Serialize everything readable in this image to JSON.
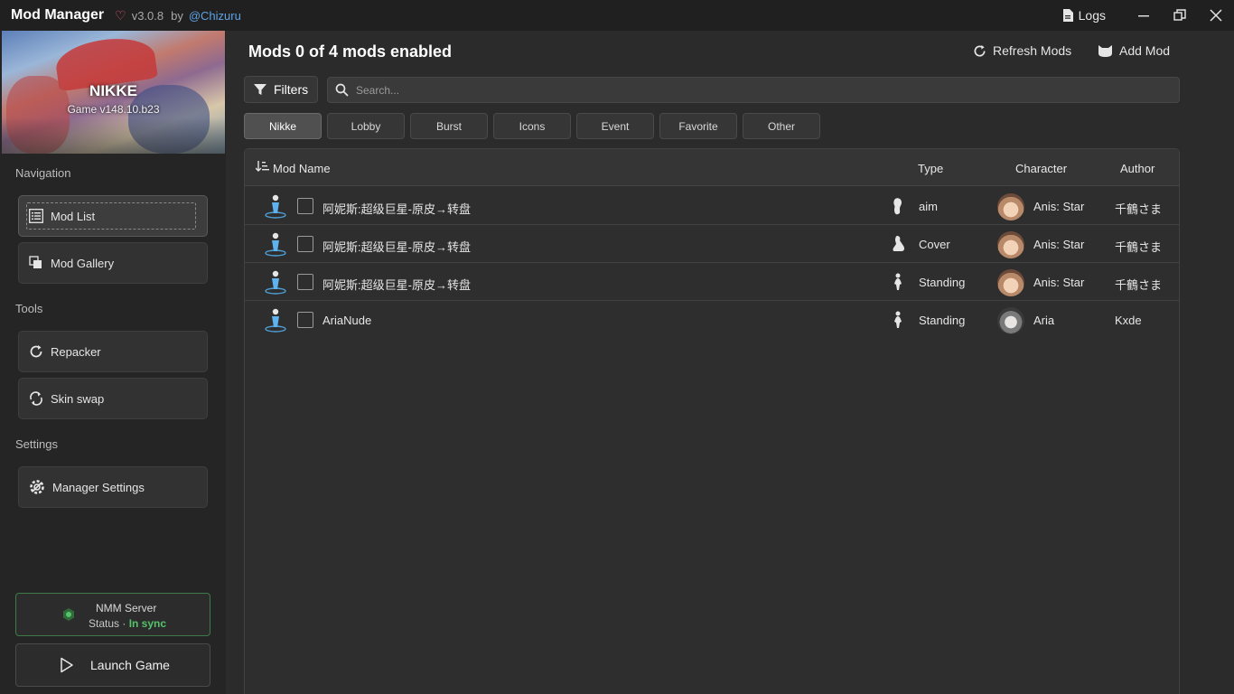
{
  "titlebar": {
    "app_title": "Mod Manager",
    "version": "v3.0.8",
    "by": "by",
    "author": "@Chizuru",
    "logs_label": "Logs"
  },
  "sidebar": {
    "banner_title": "NIKKE",
    "banner_subtitle": "Game v148.10.b23",
    "navigation_label": "Navigation",
    "nav_items": [
      {
        "label": "Mod List",
        "icon": "list-icon"
      },
      {
        "label": "Mod Gallery",
        "icon": "gallery-icon"
      }
    ],
    "tools_label": "Tools",
    "tool_items": [
      {
        "label": "Repacker",
        "icon": "refresh-icon"
      },
      {
        "label": "Skin swap",
        "icon": "swap-icon"
      }
    ],
    "settings_label": "Settings",
    "settings_items": [
      {
        "label": "Manager Settings",
        "icon": "settings-gear-icon"
      }
    ],
    "server": {
      "title": "NMM Server",
      "status_label": "Status · ",
      "status_value": "In sync",
      "status_color": "#56c26a"
    },
    "launch_label": "Launch Game"
  },
  "main": {
    "title": "Mods 0 of 4 mods enabled",
    "refresh_label": "Refresh Mods",
    "add_label": "Add Mod",
    "filters_label": "Filters",
    "search_placeholder": "Search...",
    "chips": [
      {
        "label": "Nikke",
        "active": true
      },
      {
        "label": "Lobby",
        "active": false
      },
      {
        "label": "Burst",
        "active": false
      },
      {
        "label": "Icons",
        "active": false
      },
      {
        "label": "Event",
        "active": false
      },
      {
        "label": "Favorite",
        "active": false
      },
      {
        "label": "Other",
        "active": false
      }
    ],
    "table": {
      "headers": {
        "name": "Mod Name",
        "type": "Type",
        "character": "Character",
        "author": "Author"
      },
      "rows": [
        {
          "name": "阿妮斯:超级巨星-原皮→转盘",
          "type": "aim",
          "character": "Anis: Star",
          "author": "千鶴さま",
          "enabled": false
        },
        {
          "name": "阿妮斯:超级巨星-原皮→转盘",
          "type": "Cover",
          "character": "Anis: Star",
          "author": "千鶴さま",
          "enabled": false
        },
        {
          "name": "阿妮斯:超级巨星-原皮→转盘",
          "type": "Standing",
          "character": "Anis: Star",
          "author": "千鶴さま",
          "enabled": false
        },
        {
          "name": "AriaNude",
          "type": "Standing",
          "character": "Aria",
          "author": "Kxde",
          "enabled": false
        }
      ]
    }
  },
  "colors": {
    "accent_link": "#5ea3e6",
    "heart": "#e0566e",
    "status_green": "#56c26a"
  }
}
